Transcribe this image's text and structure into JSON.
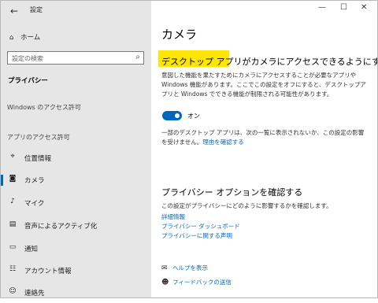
{
  "window": {
    "title": "設定",
    "back_icon": "←",
    "controls": {
      "minimize": "—",
      "maximize": "☐",
      "close": "✕"
    }
  },
  "sidebar": {
    "home": "ホーム",
    "search_placeholder": "設定の検索",
    "category": "プライバシー",
    "windows_permissions": "Windows のアクセス許可",
    "app_permissions": "アプリのアクセス許可",
    "items": [
      {
        "label": "位置情報",
        "icon": "location-icon"
      },
      {
        "label": "カメラ",
        "icon": "camera-icon"
      },
      {
        "label": "マイク",
        "icon": "microphone-icon"
      },
      {
        "label": "音声によるアクティブ化",
        "icon": "voice-activation-icon"
      },
      {
        "label": "通知",
        "icon": "notification-icon"
      },
      {
        "label": "アカウント情報",
        "icon": "account-info-icon"
      },
      {
        "label": "連絡先",
        "icon": "contacts-icon"
      }
    ]
  },
  "main": {
    "page_title": "カメラ",
    "section_title": "デスクトップ アプリがカメラにアクセスできるようにする",
    "section_desc": "意図した機能を果たすためにカメラにアクセスすることが必要なアプリや Windows 機能があります。ここでこの設定をオフにすると、デスクトップアプリと Windows でできる機能が制限される可能性があります。",
    "toggle_label": "オン",
    "note_text": "一部のデスクトップ アプリは、次の一覧に表示されないか、この設定の影響を受けません。",
    "note_link": "理由を確認する",
    "privacy_title": "プライバシー オプションを確認する",
    "privacy_desc": "この設定がプライバシーにどのように影響するかを確認します。",
    "privacy_links": [
      "詳細情報",
      "プライバシー ダッシュボード",
      "プライバシーに関する声明"
    ],
    "help": "ヘルプを表示",
    "feedback": "フィードバックの送信"
  },
  "colors": {
    "accent": "#0067c0",
    "highlight": "#ffe600",
    "sidebar_bg": "#e6e6e6"
  }
}
